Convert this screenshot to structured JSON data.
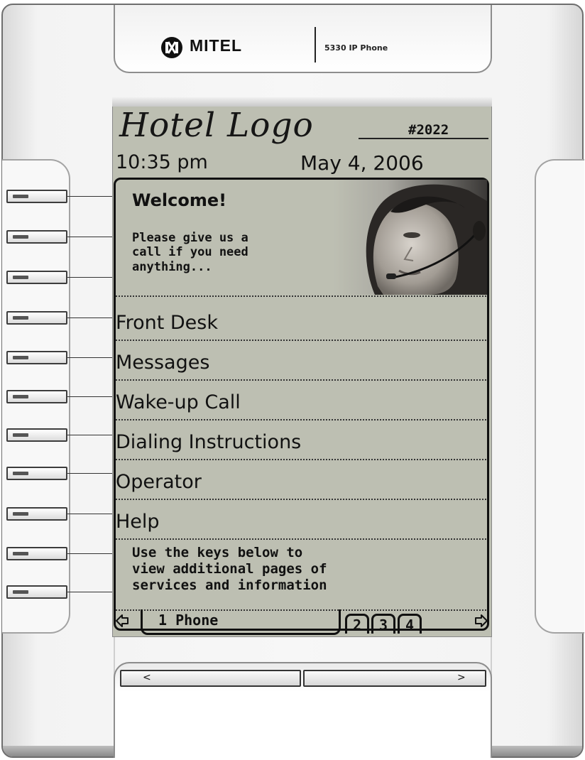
{
  "device": {
    "brand": "MITEL",
    "model": "5330 IP Phone",
    "brand_icon": "mitel-logo-icon"
  },
  "screen": {
    "hotel_logo": "Hotel Logo",
    "room_number": "#2022",
    "time": "10:35 pm",
    "date": "May 4, 2006",
    "welcome_title": "Welcome!",
    "welcome_body": "Please give us a\ncall if you need\nanything...",
    "menu": [
      {
        "label": "Front Desk"
      },
      {
        "label": "Messages"
      },
      {
        "label": "Wake-up Call"
      },
      {
        "label": "Dialing Instructions"
      },
      {
        "label": "Operator"
      },
      {
        "label": "Help"
      }
    ],
    "info_text": "Use the keys below to\nview additional pages of\nservices and information",
    "tabs": {
      "active": "1 Phone",
      "pages": [
        "2",
        "3",
        "4"
      ],
      "prev_icon": "arrow-left-icon",
      "next_icon": "arrow-right-icon"
    }
  },
  "nav_bar": {
    "left_label": "<",
    "right_label": ">"
  },
  "colors": {
    "lcd_background": "#bdbfb2",
    "lcd_text": "#111111",
    "housing": "#f3f3f3"
  }
}
